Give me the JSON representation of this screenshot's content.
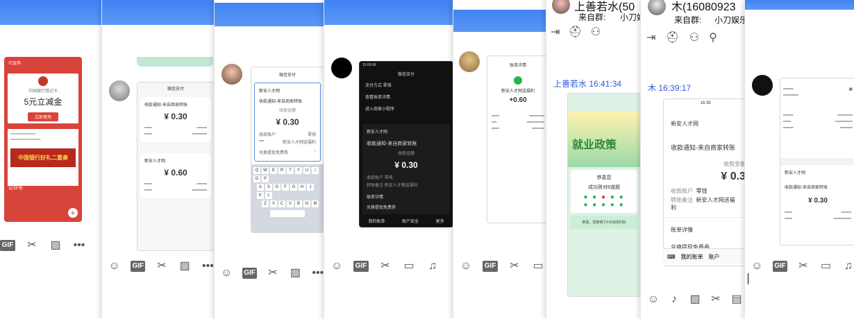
{
  "colors": {
    "topbar": "#4a8af4",
    "red_card": "#d9443a",
    "sender": "#2f5bd9"
  },
  "panel1": {
    "header": "代金券",
    "bank": "中国银行借记卡",
    "coupon": "5元立减金",
    "use_btn": "立即使用",
    "promo": "中国银行好礼二重奏",
    "footer": "公众号"
  },
  "panel2": {
    "title": "微信支付",
    "cards": [
      {
        "label": "收款通知-来自商家转账",
        "amount": "¥ 0.30"
      },
      {
        "label": "新安人才网",
        "amount": "¥ 0.60"
      }
    ]
  },
  "panel3": {
    "title": "微信支付",
    "org": "新安人才网",
    "notice": "收款通知-来自商家转账",
    "amount_label": "收款金额",
    "amount": "¥ 0.30",
    "r1": "零钱",
    "r2": "新安人才网送福利",
    "detail": "收款账户",
    "free": "兑换提现免费券",
    "keys_row1": [
      "Q",
      "W",
      "E",
      "R",
      "T",
      "Y",
      "U",
      "I",
      "O",
      "P"
    ],
    "keys_row2": [
      "A",
      "S",
      "D",
      "F",
      "G",
      "H",
      "J",
      "K",
      "L"
    ],
    "keys_row3": [
      "Z",
      "X",
      "C",
      "V",
      "B",
      "N",
      "M"
    ]
  },
  "panel4": {
    "time": "15:55:09",
    "title": "微信支付",
    "rows": [
      "支付方式 零钱",
      "查看账单详情",
      "进入商家小程序"
    ],
    "org": "新安人才网",
    "notice": "收款通知-来自商家转账",
    "amount_label": "收款金额",
    "amount": "¥ 0.30",
    "acct": "收款账户 零钱",
    "remark": "转账备注 新安人才网送福利",
    "detail": "账单详情",
    "free": "兑换提现免费券",
    "bottom": [
      "我的账单",
      "账户安全",
      "更多"
    ]
  },
  "panel5": {
    "title": "账单详情",
    "org": "新安人才网送福利",
    "amount": "+0.60"
  },
  "panel6": {
    "name": "上善若水(50",
    "from": "来自群:",
    "group": "小刀娱",
    "sender": "上善若水",
    "time": "16:41:34",
    "banner": "就业政策",
    "result": "恭喜您",
    "success": "成功答对8道题",
    "footer": "恭喜，您获得了0.6元的红包!"
  },
  "panel7": {
    "name": "木(16080923",
    "from": "来自群:",
    "group": "小刀娱乐",
    "sender": "木",
    "time": "16:39:17",
    "phone_time": "16:39",
    "org": "新安人才网",
    "notice": "收款通知-来自商家转账",
    "amount_label": "收款金额",
    "amount": "¥ 0.3",
    "acct_label": "收款账户",
    "acct": "零钱",
    "remark_label": "转账备注",
    "remark": "新安人才网送福利",
    "detail": "账单详情",
    "free": "兑换提现免费券",
    "bottom": [
      "我的账单",
      "账户"
    ]
  },
  "panel8": {
    "org": "新安人才网",
    "notice": "收款通知-来自商家转账",
    "amount": "¥ 0.30"
  }
}
